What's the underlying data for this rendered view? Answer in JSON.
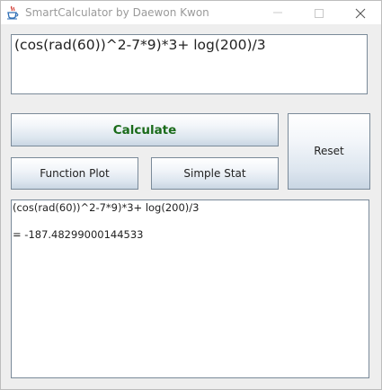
{
  "window": {
    "title": "SmartCalculator by Daewon Kwon",
    "icon": "java-cup-icon",
    "controls": {
      "minimize": "minimize-icon",
      "maximize": "maximize-icon",
      "close": "close-icon"
    }
  },
  "input": {
    "value": "(cos(rad(60))^2-7*9)*3+ log(200)/3"
  },
  "buttons": {
    "calculate": "Calculate",
    "reset": "Reset",
    "function_plot": "Function Plot",
    "simple_stat": "Simple Stat"
  },
  "output": {
    "expression": "(cos(rad(60))^2-7*9)*3+ log(200)/3",
    "result": "= -187.48299000144533"
  },
  "colors": {
    "calculate_text": "#1a6b1a",
    "button_border": "#7a8a99",
    "title_text": "#9a9a9a"
  }
}
